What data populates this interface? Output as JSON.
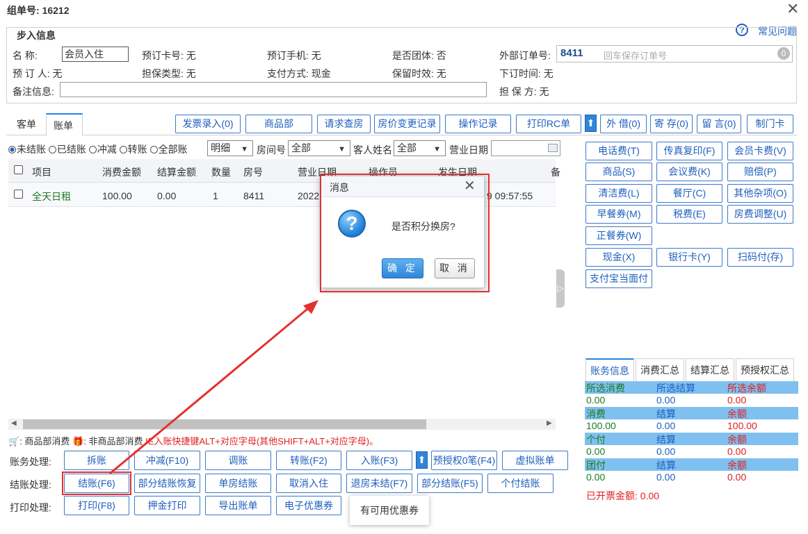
{
  "window": {
    "title": "组单号: 16212"
  },
  "help": {
    "icon": "?",
    "label": "常见问题"
  },
  "section": {
    "legend": "步入信息"
  },
  "info": {
    "name_label": "名 称:",
    "name_value": "会员入住",
    "card_label": "预订卡号: 无",
    "phone_label": "预订手机: 无",
    "group_label": "是否团体: 否",
    "ext_label": "外部订单号:",
    "ext_value": "8411",
    "ext_placeholder": "回车保存订单号",
    "ext_badge": "0",
    "booker_label": "预 订 人: 无",
    "guarantee_type": "担保类型: 无",
    "pay_method": "支付方式: 现金",
    "keep_time": "保留时效: 无",
    "order_time": "下订时间: 无",
    "remark_label": "备注信息:",
    "guarantor": "担 保 方: 无"
  },
  "tabs": [
    "客单",
    "账单"
  ],
  "top_buttons": [
    "发票录入(0)",
    "商品部",
    "请求查房",
    "房价变更记录",
    "操作记录",
    "打印RC单",
    "外 借(0)",
    "寄 存(0)",
    "留 言(0)",
    "制门卡"
  ],
  "up_arrow": "⬆",
  "filters": {
    "radios": [
      "未结账",
      "已结账",
      "冲减",
      "转账",
      "全部账"
    ],
    "detail_select": "明细",
    "room_label": "房间号",
    "room_select": "全部",
    "guest_label": "客人姓名",
    "guest_select": "全部",
    "bizdate_label": "营业日期"
  },
  "grid": {
    "headers": [
      "项目",
      "消费金额",
      "结算金额",
      "数量",
      "房号",
      "营业日期",
      "操作员",
      "发生日期",
      "备"
    ],
    "row": [
      "全天日租",
      "100.00",
      "0.00",
      "1",
      "8411",
      "2022",
      "9 09:57:55"
    ]
  },
  "side_buttons": [
    [
      "电话费(T)",
      "传真复印(F)",
      "会员卡费(V)"
    ],
    [
      "商品(S)",
      "会议费(K)",
      "赔偿(P)"
    ],
    [
      "清洁费(L)",
      "餐厅(C)",
      "其他杂项(O)"
    ],
    [
      "早餐券(M)",
      "税费(E)",
      "房费调整(U)"
    ],
    [
      "正餐券(W)"
    ],
    [
      "现金(X)",
      "银行卡(Y)",
      "扫码付(存)"
    ],
    [
      "支付宝当面付"
    ]
  ],
  "info_tabs": [
    "账务信息",
    "消费汇总",
    "结算汇总",
    "预授权汇总"
  ],
  "summary": [
    {
      "labels": [
        "所选消费",
        "所选结算",
        "所选余额"
      ],
      "values": [
        "0.00",
        "0.00",
        "0.00"
      ]
    },
    {
      "labels": [
        "消费",
        "结算",
        "余额"
      ],
      "values": [
        "100.00",
        "0.00",
        "100.00"
      ]
    },
    {
      "labels": [
        "个付",
        "结算",
        "余额"
      ],
      "values": [
        "0.00",
        "0.00",
        "0.00"
      ]
    },
    {
      "labels": [
        "团付",
        "结算",
        "余额"
      ],
      "values": [
        "0.00",
        "0.00",
        "0.00"
      ]
    }
  ],
  "invoiced": "已开票金额: 0.00",
  "legend_line": {
    "a": ": 商品部消费",
    "b": ": 非商品部消费",
    "hint": "IE入账快捷键ALT+对应字母(其他SHIFT+ALT+对应字母)。"
  },
  "actions": {
    "account_label": "账务处理:",
    "account_buttons": [
      "拆账",
      "冲减(F10)",
      "调账",
      "转账(F2)",
      "入账(F3)",
      "预授权0笔(F4)",
      "虚拟账单"
    ],
    "settle_label": "结账处理:",
    "settle_buttons": [
      "结账(F6)",
      "部分结账恢复",
      "单房结账",
      "取消入住",
      "退房未结(F7)",
      "部分结账(F5)",
      "个付结账"
    ],
    "print_label": "打印处理:",
    "print_buttons": [
      "打印(F8)",
      "押金打印",
      "导出账单",
      "电子优惠券"
    ]
  },
  "tooltip": "有可用优惠券",
  "dialog": {
    "title": "消息",
    "message": "是否积分换房?",
    "ok": "确 定",
    "cancel": "取 消"
  },
  "colors": {
    "accent": "#1e5fbf",
    "highlight": "#e53030",
    "stripe": "#7fc0f0"
  }
}
